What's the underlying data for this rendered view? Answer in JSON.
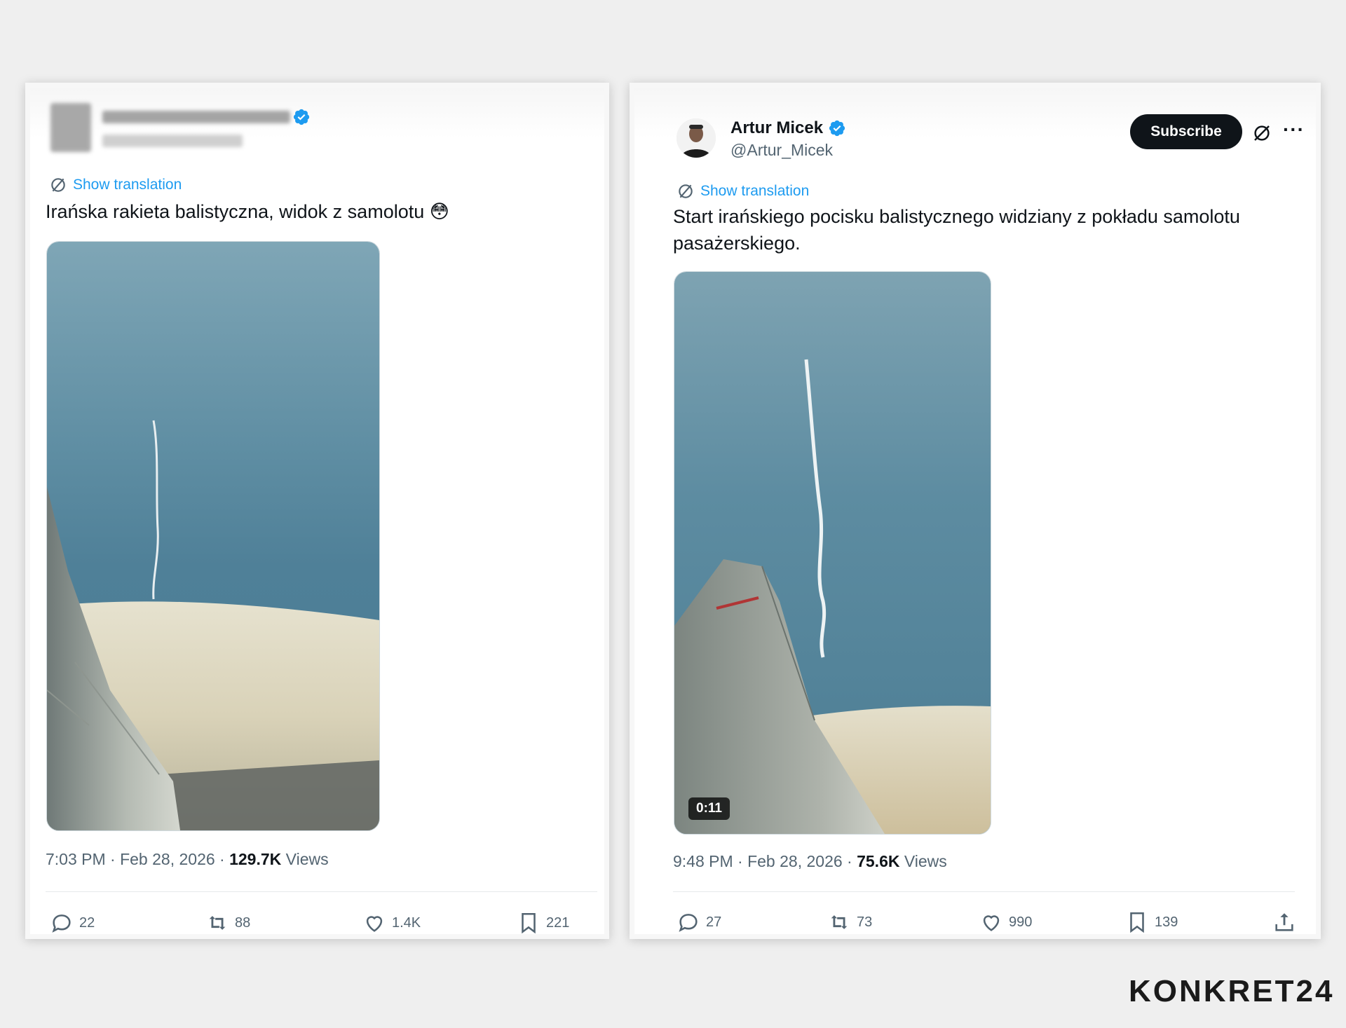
{
  "tweet1": {
    "translate_label": "Show translation",
    "text": "Irańska rakieta balistyczna, widok z samolotu 😳",
    "time": "7:03 PM · Feb 28, 2026 · ",
    "views_count": "129.7K",
    "views_label": " Views",
    "replies": "22",
    "reposts": "88",
    "likes": "1.4K",
    "bookmarks": "221"
  },
  "tweet2": {
    "author_name": "Artur Micek",
    "author_handle": "@Artur_Micek",
    "subscribe_label": "Subscribe",
    "more_label": "···",
    "translate_label": "Show translation",
    "text_line1": "Start irańskiego pocisku balistycznego widziany z pokładu samolotu",
    "text_line2": "pasażerskiego.",
    "video_duration": "0:11",
    "time": "9:48 PM · Feb 28, 2026 · ",
    "views_count": "75.6K",
    "views_label": " Views",
    "replies": "27",
    "reposts": "73",
    "likes": "990",
    "bookmarks": "139"
  },
  "branding": {
    "logo_text": "KONKRET24"
  },
  "colors": {
    "accent": "#1d9bf0",
    "text": "#0f1419",
    "muted": "#536471"
  },
  "icons": [
    "verified-badge-icon",
    "translate-icon",
    "reply-icon",
    "repost-icon",
    "like-icon",
    "bookmark-icon",
    "share-icon",
    "grok-icon"
  ]
}
